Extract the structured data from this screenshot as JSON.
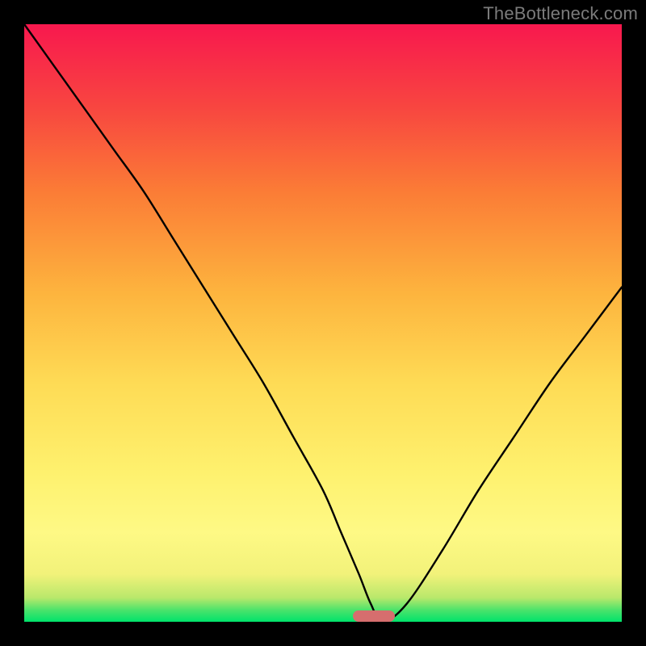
{
  "watermark": "TheBottleneck.com",
  "colors": {
    "frame": "#000000",
    "marker": "#d66e6e",
    "curve": "#000000"
  },
  "chart_data": {
    "type": "line",
    "title": "",
    "xlabel": "",
    "ylabel": "",
    "xlim": [
      0,
      100
    ],
    "ylim": [
      0,
      100
    ],
    "x": [
      0,
      5,
      10,
      15,
      20,
      25,
      30,
      35,
      40,
      45,
      50,
      53,
      56,
      58,
      60,
      64,
      70,
      76,
      82,
      88,
      94,
      100
    ],
    "values": [
      100,
      93,
      86,
      79,
      72,
      64,
      56,
      48,
      40,
      31,
      22,
      15,
      8,
      3,
      0,
      3,
      12,
      22,
      31,
      40,
      48,
      56
    ],
    "marker_range_x": [
      55,
      62
    ],
    "legend": false,
    "grid": false
  }
}
